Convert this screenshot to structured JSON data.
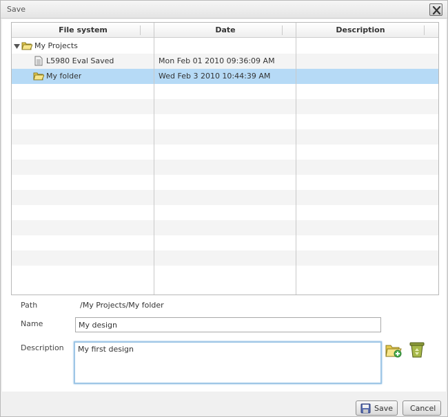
{
  "window": {
    "title": "Save"
  },
  "grid": {
    "columns": [
      "File system",
      "Date",
      "Description"
    ],
    "rows": [
      {
        "name": "My Projects",
        "date": "",
        "description": "",
        "type": "folder-open",
        "expanded": true,
        "selected": false
      },
      {
        "name": "L5980 Eval Saved",
        "date": "Mon Feb 01 2010 09:36:09 AM",
        "description": "",
        "type": "document",
        "selected": false
      },
      {
        "name": "My folder",
        "date": "Wed Feb 3 2010 10:44:39 AM",
        "description": "",
        "type": "folder",
        "selected": true
      }
    ]
  },
  "form": {
    "path_label": "Path",
    "path_value": "/My Projects/My folder",
    "name_label": "Name",
    "name_value": "My design",
    "description_label": "Description",
    "description_value": "My first design"
  },
  "icons": {
    "close": "close-icon",
    "tree_toggle": "triangle-down-icon",
    "new_folder": "new-folder-icon",
    "delete": "recycle-bin-icon",
    "save_button": "floppy-disk-icon"
  },
  "buttons": {
    "save": "Save",
    "cancel": "Cancel"
  },
  "colors": {
    "selected_row": "#b6daf6",
    "focus_border": "#9ec6e6"
  }
}
